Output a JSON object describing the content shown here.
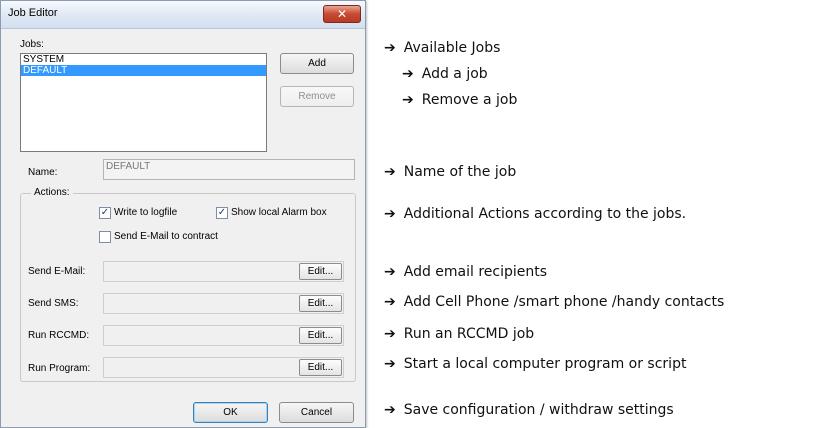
{
  "window": {
    "title": "Job Editor",
    "close_glyph": "✕"
  },
  "jobs": {
    "label": "Jobs:",
    "items": [
      "SYSTEM",
      "DEFAULT"
    ],
    "selected_index": 1,
    "add_label": "Add",
    "remove_label": "Remove"
  },
  "name": {
    "label": "Name:",
    "value": "DEFAULT"
  },
  "actions": {
    "legend": "Actions:",
    "write_logfile": {
      "label": "Write to logfile",
      "checked": true
    },
    "show_alarm": {
      "label": "Show local Alarm box",
      "checked": true
    },
    "send_email_contract": {
      "label": "Send E-Mail to contract",
      "checked": false
    }
  },
  "fields": [
    {
      "label": "Send E-Mail:",
      "button": "Edit..."
    },
    {
      "label": "Send SMS:",
      "button": "Edit..."
    },
    {
      "label": "Run RCCMD:",
      "button": "Edit..."
    },
    {
      "label": "Run Program:",
      "button": "Edit..."
    }
  ],
  "footer": {
    "ok_label": "OK",
    "cancel_label": "Cancel"
  },
  "annotations": {
    "arrow": "➔",
    "available_jobs": "Available Jobs",
    "add_job": "Add a job",
    "remove_job": "Remove a job",
    "name_of_job": "Name of the job",
    "additional_actions": "Additional Actions according to the jobs.",
    "email_recipients": "Add email recipients",
    "cell_phone": "Add Cell Phone /smart phone /handy contacts",
    "rccmd_job": "Run an RCCMD job",
    "local_program": "Start a local computer program or script",
    "save_config": "Save configuration / withdraw settings"
  },
  "colors": {
    "selection": "#3399ff",
    "close_button": "#c74a32"
  }
}
